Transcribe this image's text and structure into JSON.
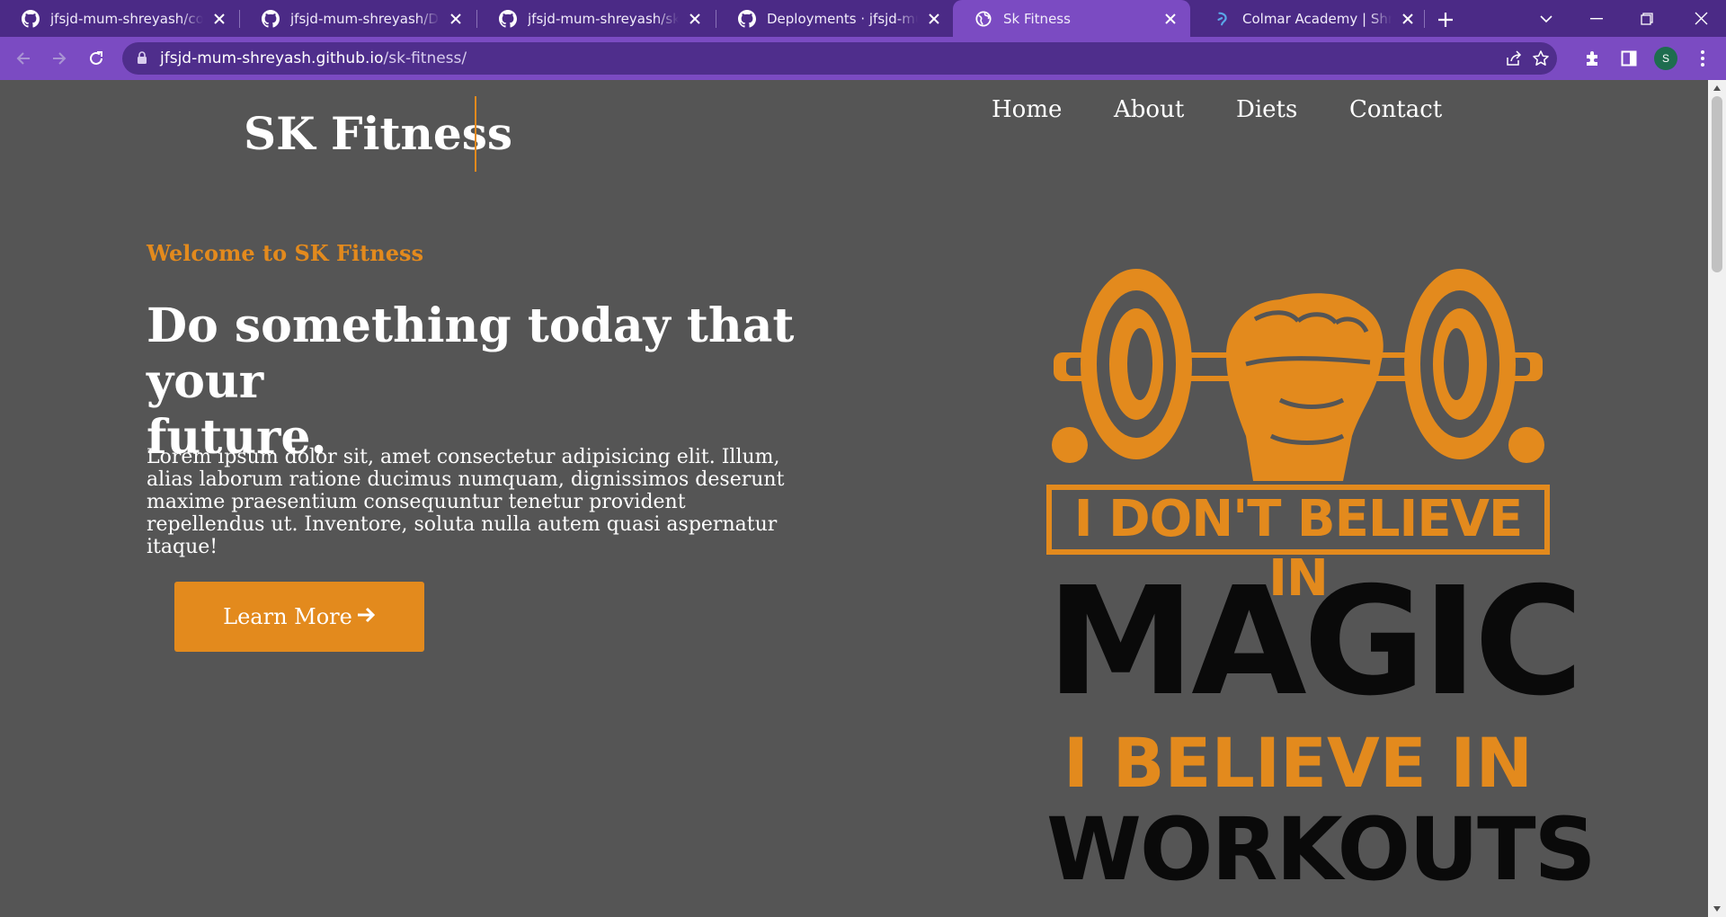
{
  "browser": {
    "tabs": [
      {
        "title": "jfsjd-mum-shreyash/colmar-academy",
        "icon": "github-icon",
        "active": false
      },
      {
        "title": "jfsjd-mum-shreyash/Dasmoto",
        "icon": "github-icon",
        "active": false
      },
      {
        "title": "jfsjd-mum-shreyash/sk-fitness",
        "icon": "github-icon",
        "active": false
      },
      {
        "title": "Deployments · jfsjd-mum-shreyash",
        "icon": "github-icon",
        "active": false
      },
      {
        "title": "Sk Fitness",
        "icon": "globe-icon",
        "active": true
      },
      {
        "title": "Colmar Academy | Shreyash",
        "icon": "colmar-icon",
        "active": false
      }
    ],
    "url_domain": "jfsjd-mum-shreyash.github.io",
    "url_path": "/sk-fitness/",
    "profile_initial": "S",
    "colors": {
      "frame": "#4b2a86",
      "toolbar": "#7b4bc2",
      "omnibox": "#4f2e8c"
    }
  },
  "site": {
    "brand": "SK Fitness",
    "nav": [
      "Home",
      "About",
      "Diets",
      "Contact"
    ],
    "welcome": "Welcome to SK Fitness",
    "headline_line1": "Do something today that your",
    "headline_line2": "future.",
    "lorem": "Lorem ipsum dolor sit, amet consectetur adipisicing elit. Illum, alias laborum ratione ducimus numquam, dignissimos deserunt maxime praesentium consequuntur tenetur provident repellendus ut. Inventore, soluta nulla autem quasi aspernatur itaque!",
    "cta_label": "Learn More",
    "poster": {
      "line1": "I DON'T BELIEVE IN",
      "line2": "MAGIC",
      "line3": "I BELIEVE IN",
      "line4": "WORKOUTS"
    },
    "colors": {
      "background": "#555555",
      "accent": "#e38a1d",
      "text": "#ffffff",
      "poster_dark": "#0a0a0a"
    }
  }
}
